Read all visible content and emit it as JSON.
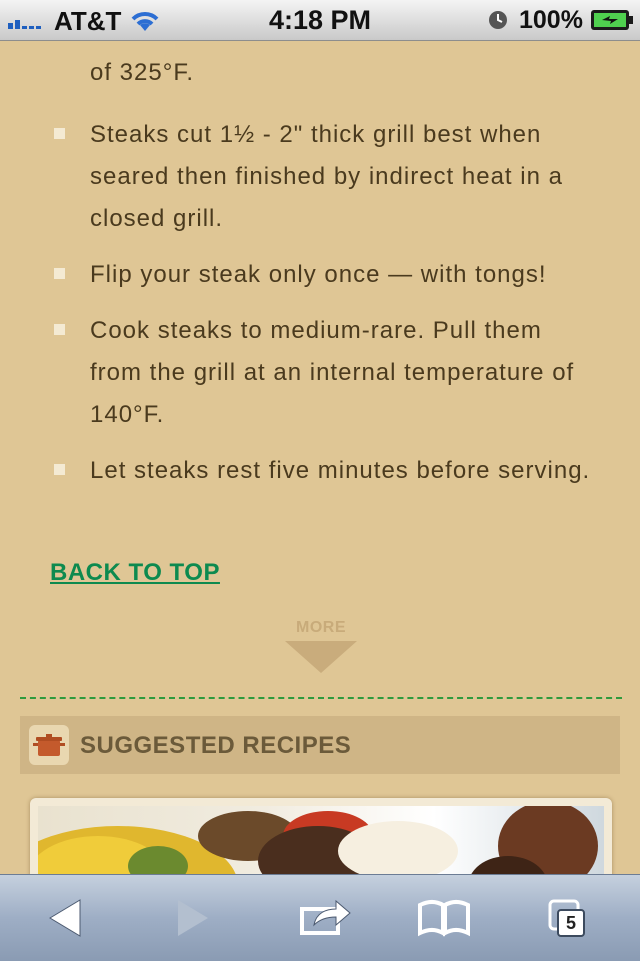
{
  "status_bar": {
    "carrier": "AT&T",
    "time": "4:18 PM",
    "battery": "100%"
  },
  "article": {
    "fragment_line": "of 325°F.",
    "tips": [
      "Steaks cut 1½ - 2\" thick grill best when seared then finished by indirect heat in a closed grill.",
      "Flip your steak only once — with tongs!",
      "Cook steaks to medium-rare. Pull them from the grill at an internal temperature of 140°F.",
      "Let steaks rest five minutes before serving."
    ],
    "back_to_top": "BACK TO TOP",
    "more": "MORE"
  },
  "suggested": {
    "title": "SUGGESTED RECIPES"
  },
  "toolbar": {
    "tab_count": "5"
  },
  "colors": {
    "page_bg": "#dfc695",
    "link": "#0d8a4f",
    "text": "#4a3a1e",
    "divider": "#2f9a3c"
  }
}
